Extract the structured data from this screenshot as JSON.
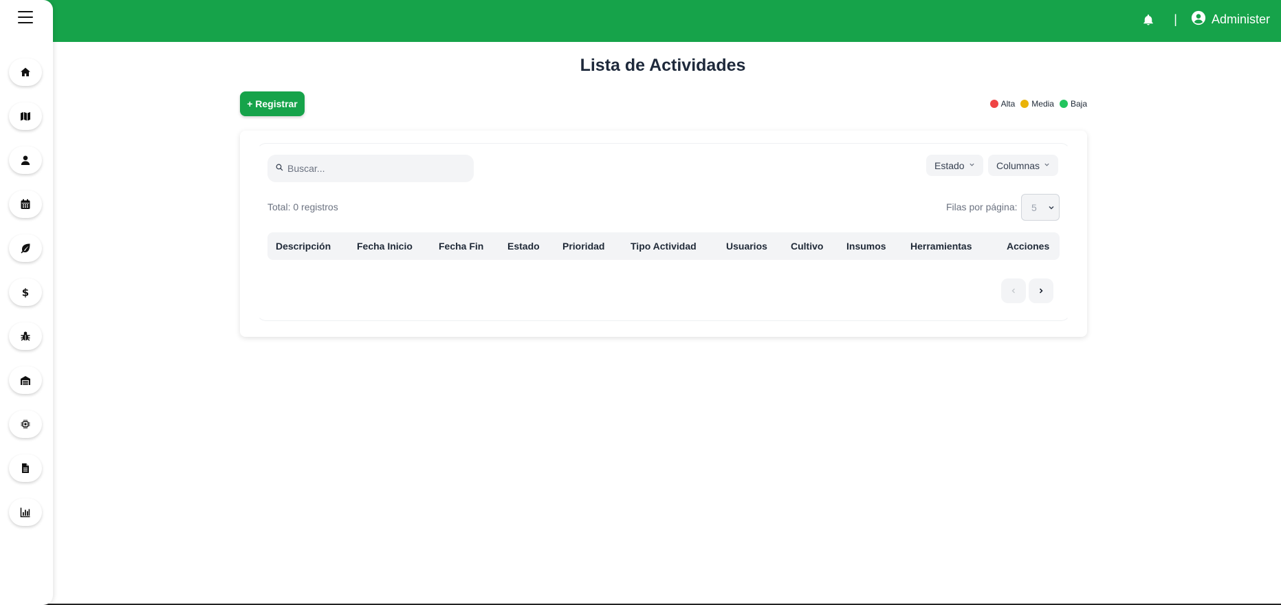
{
  "header": {
    "user_name": "Administer",
    "separator": "|",
    "brand_color": "#16a34a"
  },
  "sidebar": {
    "items": [
      {
        "name": "home-icon"
      },
      {
        "name": "map-icon"
      },
      {
        "name": "user-icon"
      },
      {
        "name": "calendar-icon"
      },
      {
        "name": "leaf-icon"
      },
      {
        "name": "dollar-icon"
      },
      {
        "name": "bug-icon"
      },
      {
        "name": "warehouse-icon"
      },
      {
        "name": "microchip-icon"
      },
      {
        "name": "document-icon"
      },
      {
        "name": "chart-icon"
      }
    ]
  },
  "page": {
    "title": "Lista de Actividades",
    "register_label": "+ Registrar"
  },
  "legend": [
    {
      "label": "Alta",
      "color": "#ef4444"
    },
    {
      "label": "Media",
      "color": "#eab308"
    },
    {
      "label": "Baja",
      "color": "#22c55e"
    }
  ],
  "toolbar": {
    "search_placeholder": "Buscar...",
    "estado_label": "Estado",
    "columnas_label": "Columnas"
  },
  "summary": {
    "total_text": "Total: 0 registros",
    "rows_per_page_label": "Filas por página:",
    "rows_per_page_value": "5"
  },
  "table": {
    "columns": [
      "Descripción",
      "Fecha Inicio",
      "Fecha Fin",
      "Estado",
      "Prioridad",
      "Tipo Actividad",
      "Usuarios",
      "Cultivo",
      "Insumos",
      "Herramientas",
      "Acciones"
    ],
    "rows": []
  }
}
